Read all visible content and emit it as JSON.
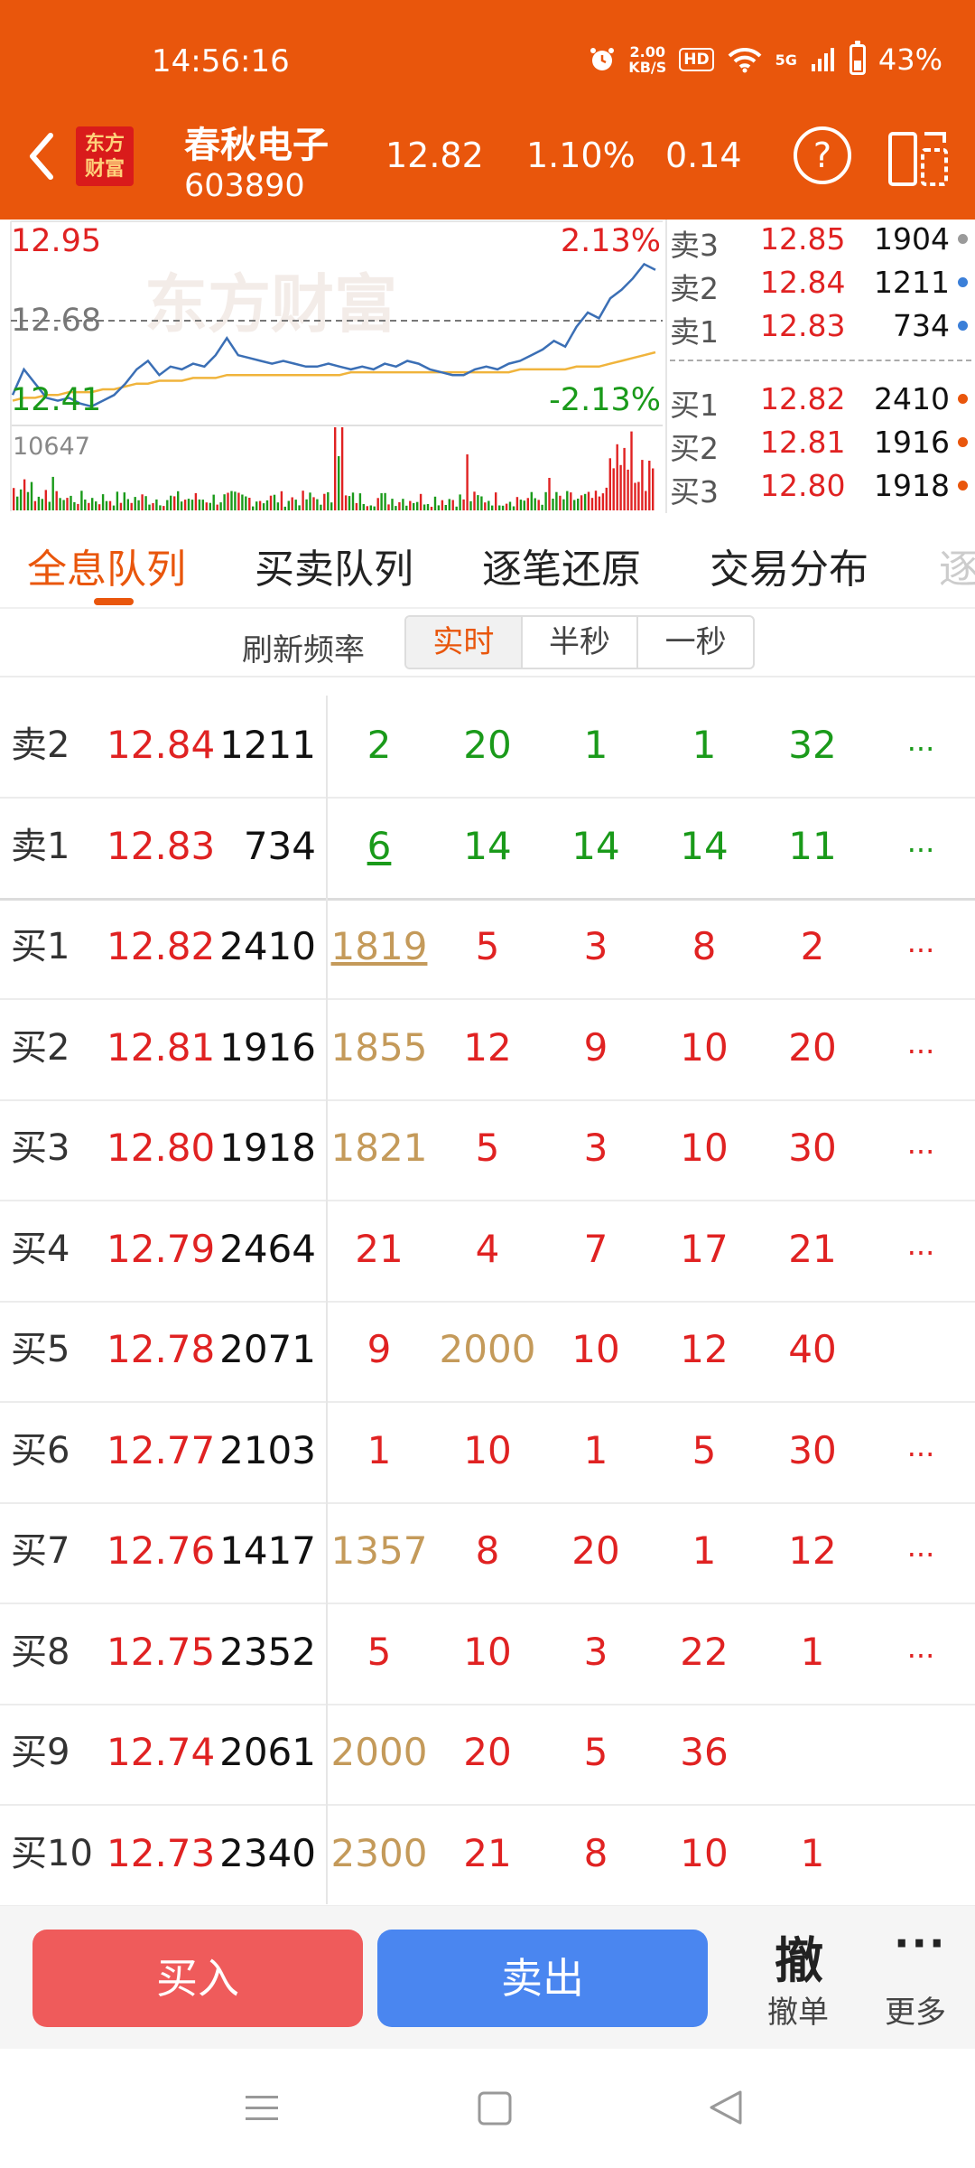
{
  "status_bar": {
    "time": "14:56:16",
    "speed_value": "2.00",
    "speed_unit": "KB/S",
    "hd": "HD",
    "network": "5G",
    "battery": "43%"
  },
  "header": {
    "logo_line1": "东方",
    "logo_line2": "财富",
    "stock_name": "春秋电子",
    "stock_code": "603890",
    "price": "12.82",
    "change_pct": "1.10%",
    "change": "0.14",
    "help_glyph": "?"
  },
  "mini_chart": {
    "high_price": "12.95",
    "high_pct": "2.13%",
    "prev_close": "12.68",
    "low_price": "12.41",
    "low_pct": "-2.13%",
    "max_volume": "10647",
    "watermark": "东方财富",
    "colors": {
      "price_line": "#3b6fb5",
      "avg_line": "#f0b43c",
      "up": "#e02222",
      "down": "#1a9a1a"
    }
  },
  "chart_data": {
    "type": "line",
    "ylim": [
      12.41,
      12.95
    ],
    "reference_value": 12.68,
    "series": [
      {
        "values": [
          12.46,
          12.55,
          12.5,
          12.45,
          12.44,
          12.45,
          12.43,
          12.42,
          12.44,
          12.46,
          12.5,
          12.55,
          12.58,
          12.53,
          12.56,
          12.55,
          12.57,
          12.56,
          12.6,
          12.66,
          12.6,
          12.59,
          12.58,
          12.57,
          12.58,
          12.57,
          12.56,
          12.56,
          12.57,
          12.56,
          12.55,
          12.56,
          12.55,
          12.57,
          12.56,
          12.58,
          12.57,
          12.55,
          12.54,
          12.53,
          12.53,
          12.55,
          12.56,
          12.55,
          12.57,
          12.58,
          12.6,
          12.62,
          12.65,
          12.63,
          12.7,
          12.75,
          12.73,
          12.8,
          12.83,
          12.87,
          12.92,
          12.9
        ]
      },
      {
        "values": [
          12.44,
          12.45,
          12.45,
          12.46,
          12.46,
          12.47,
          12.47,
          12.47,
          12.48,
          12.48,
          12.49,
          12.5,
          12.5,
          12.51,
          12.51,
          12.51,
          12.52,
          12.52,
          12.52,
          12.53,
          12.53,
          12.53,
          12.53,
          12.53,
          12.53,
          12.53,
          12.53,
          12.53,
          12.53,
          12.53,
          12.54,
          12.54,
          12.54,
          12.54,
          12.54,
          12.54,
          12.54,
          12.54,
          12.54,
          12.54,
          12.54,
          12.54,
          12.54,
          12.54,
          12.54,
          12.55,
          12.55,
          12.55,
          12.55,
          12.55,
          12.56,
          12.56,
          12.56,
          12.57,
          12.58,
          12.59,
          12.6,
          12.61
        ]
      }
    ]
  },
  "order_book": [
    {
      "label": "卖3",
      "price": "12.85",
      "volume": "1904",
      "dot_color": "#9a9a9a"
    },
    {
      "label": "卖2",
      "price": "12.84",
      "volume": "1211",
      "dot_color": "#3b7fd8"
    },
    {
      "label": "卖1",
      "price": "12.83",
      "volume": "734",
      "dot_color": "#3b7fd8"
    },
    {
      "label": "买1",
      "price": "12.82",
      "volume": "2410",
      "dot_color": "#e9560c"
    },
    {
      "label": "买2",
      "price": "12.81",
      "volume": "1916",
      "dot_color": "#e9560c"
    },
    {
      "label": "买3",
      "price": "12.80",
      "volume": "1918",
      "dot_color": "#e9560c"
    }
  ],
  "tabs": [
    "全息队列",
    "买卖队列",
    "逐笔还原",
    "交易分布",
    "逐"
  ],
  "refresh": {
    "label": "刷新频率",
    "options": [
      "实时",
      "半秒",
      "一秒"
    ],
    "selected": "实时"
  },
  "queue": [
    {
      "label": "卖2",
      "price": "12.84",
      "volume": "1211",
      "orders": [
        "2",
        "20",
        "1",
        "1",
        "32"
      ],
      "more": "...",
      "side": "sell"
    },
    {
      "label": "卖1",
      "price": "12.83",
      "volume": "734",
      "orders": [
        "6",
        "14",
        "14",
        "14",
        "11"
      ],
      "more": "...",
      "side": "sell"
    },
    {
      "label": "买1",
      "price": "12.82",
      "volume": "2410",
      "orders": [
        "1819",
        "5",
        "3",
        "8",
        "2"
      ],
      "more": "...",
      "side": "buy"
    },
    {
      "label": "买2",
      "price": "12.81",
      "volume": "1916",
      "orders": [
        "1855",
        "12",
        "9",
        "10",
        "20"
      ],
      "more": "...",
      "side": "buy"
    },
    {
      "label": "买3",
      "price": "12.80",
      "volume": "1918",
      "orders": [
        "1821",
        "5",
        "3",
        "10",
        "30"
      ],
      "more": "...",
      "side": "buy"
    },
    {
      "label": "买4",
      "price": "12.79",
      "volume": "2464",
      "orders": [
        "21",
        "4",
        "7",
        "17",
        "21"
      ],
      "more": "...",
      "side": "buy"
    },
    {
      "label": "买5",
      "price": "12.78",
      "volume": "2071",
      "orders": [
        "9",
        "2000",
        "10",
        "12",
        "40"
      ],
      "more": "",
      "side": "buy"
    },
    {
      "label": "买6",
      "price": "12.77",
      "volume": "2103",
      "orders": [
        "1",
        "10",
        "1",
        "5",
        "30"
      ],
      "more": "...",
      "side": "buy"
    },
    {
      "label": "买7",
      "price": "12.76",
      "volume": "1417",
      "orders": [
        "1357",
        "8",
        "20",
        "1",
        "12"
      ],
      "more": "...",
      "side": "buy"
    },
    {
      "label": "买8",
      "price": "12.75",
      "volume": "2352",
      "orders": [
        "5",
        "10",
        "3",
        "22",
        "1"
      ],
      "more": "...",
      "side": "buy"
    },
    {
      "label": "买9",
      "price": "12.74",
      "volume": "2061",
      "orders": [
        "2000",
        "20",
        "5",
        "36",
        ""
      ],
      "more": "",
      "side": "buy"
    },
    {
      "label": "买10",
      "price": "12.73",
      "volume": "2340",
      "orders": [
        "2300",
        "21",
        "8",
        "10",
        "1"
      ],
      "more": "",
      "side": "buy"
    }
  ],
  "colors": {
    "accent": "#e9560c",
    "up": "#e02222",
    "down": "#1a9a1a",
    "large_order": "#c49a5a"
  },
  "actions": {
    "buy": "买入",
    "sell": "卖出",
    "cancel_glyph": "撤",
    "cancel": "撤单",
    "more_glyph": "···",
    "more": "更多"
  }
}
